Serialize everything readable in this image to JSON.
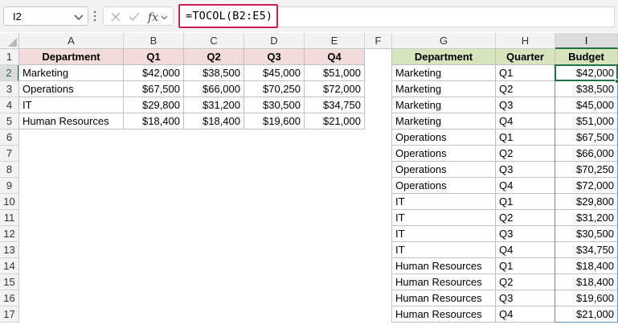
{
  "name_box": {
    "value": "I2"
  },
  "formula": {
    "text": "=TOCOL(B2:E5)"
  },
  "columns": [
    "A",
    "B",
    "C",
    "D",
    "E",
    "F",
    "G",
    "H",
    "I"
  ],
  "rows": [
    "1",
    "2",
    "3",
    "4",
    "5",
    "6",
    "7",
    "8",
    "9",
    "10",
    "11",
    "12",
    "13",
    "14",
    "15",
    "16",
    "17"
  ],
  "source_table": {
    "headers": [
      "Department",
      "Q1",
      "Q2",
      "Q3",
      "Q4"
    ],
    "rows": [
      [
        "Marketing",
        "$42,000",
        "$38,500",
        "$45,000",
        "$51,000"
      ],
      [
        "Operations",
        "$67,500",
        "$66,000",
        "$70,250",
        "$72,000"
      ],
      [
        "IT",
        "$29,800",
        "$31,200",
        "$30,500",
        "$34,750"
      ],
      [
        "Human Resources",
        "$18,400",
        "$18,400",
        "$19,600",
        "$21,000"
      ]
    ]
  },
  "result_table": {
    "headers": [
      "Department",
      "Quarter",
      "Budget"
    ],
    "rows": [
      [
        "Marketing",
        "Q1",
        "$42,000"
      ],
      [
        "Marketing",
        "Q2",
        "$38,500"
      ],
      [
        "Marketing",
        "Q3",
        "$45,000"
      ],
      [
        "Marketing",
        "Q4",
        "$51,000"
      ],
      [
        "Operations",
        "Q1",
        "$67,500"
      ],
      [
        "Operations",
        "Q2",
        "$66,000"
      ],
      [
        "Operations",
        "Q3",
        "$70,250"
      ],
      [
        "Operations",
        "Q4",
        "$72,000"
      ],
      [
        "IT",
        "Q1",
        "$29,800"
      ],
      [
        "IT",
        "Q2",
        "$31,200"
      ],
      [
        "IT",
        "Q3",
        "$30,500"
      ],
      [
        "IT",
        "Q4",
        "$34,750"
      ],
      [
        "Human Resources",
        "Q1",
        "$18,400"
      ],
      [
        "Human Resources",
        "Q2",
        "$18,400"
      ],
      [
        "Human Resources",
        "Q3",
        "$19,600"
      ],
      [
        "Human Resources",
        "Q4",
        "$21,000"
      ]
    ]
  },
  "colors": {
    "source_header_fill": "#f2dcdb",
    "result_header_fill": "#d8e4bc",
    "formula_highlight": "#c8234a",
    "selection": "#217346"
  },
  "icons": {
    "name_box_dropdown": "chevron-down-icon",
    "more_options": "vertical-dots-icon",
    "cancel": "x-icon",
    "enter": "check-icon",
    "insert_function": "fx-icon",
    "select_all": "select-all-triangle-icon"
  }
}
